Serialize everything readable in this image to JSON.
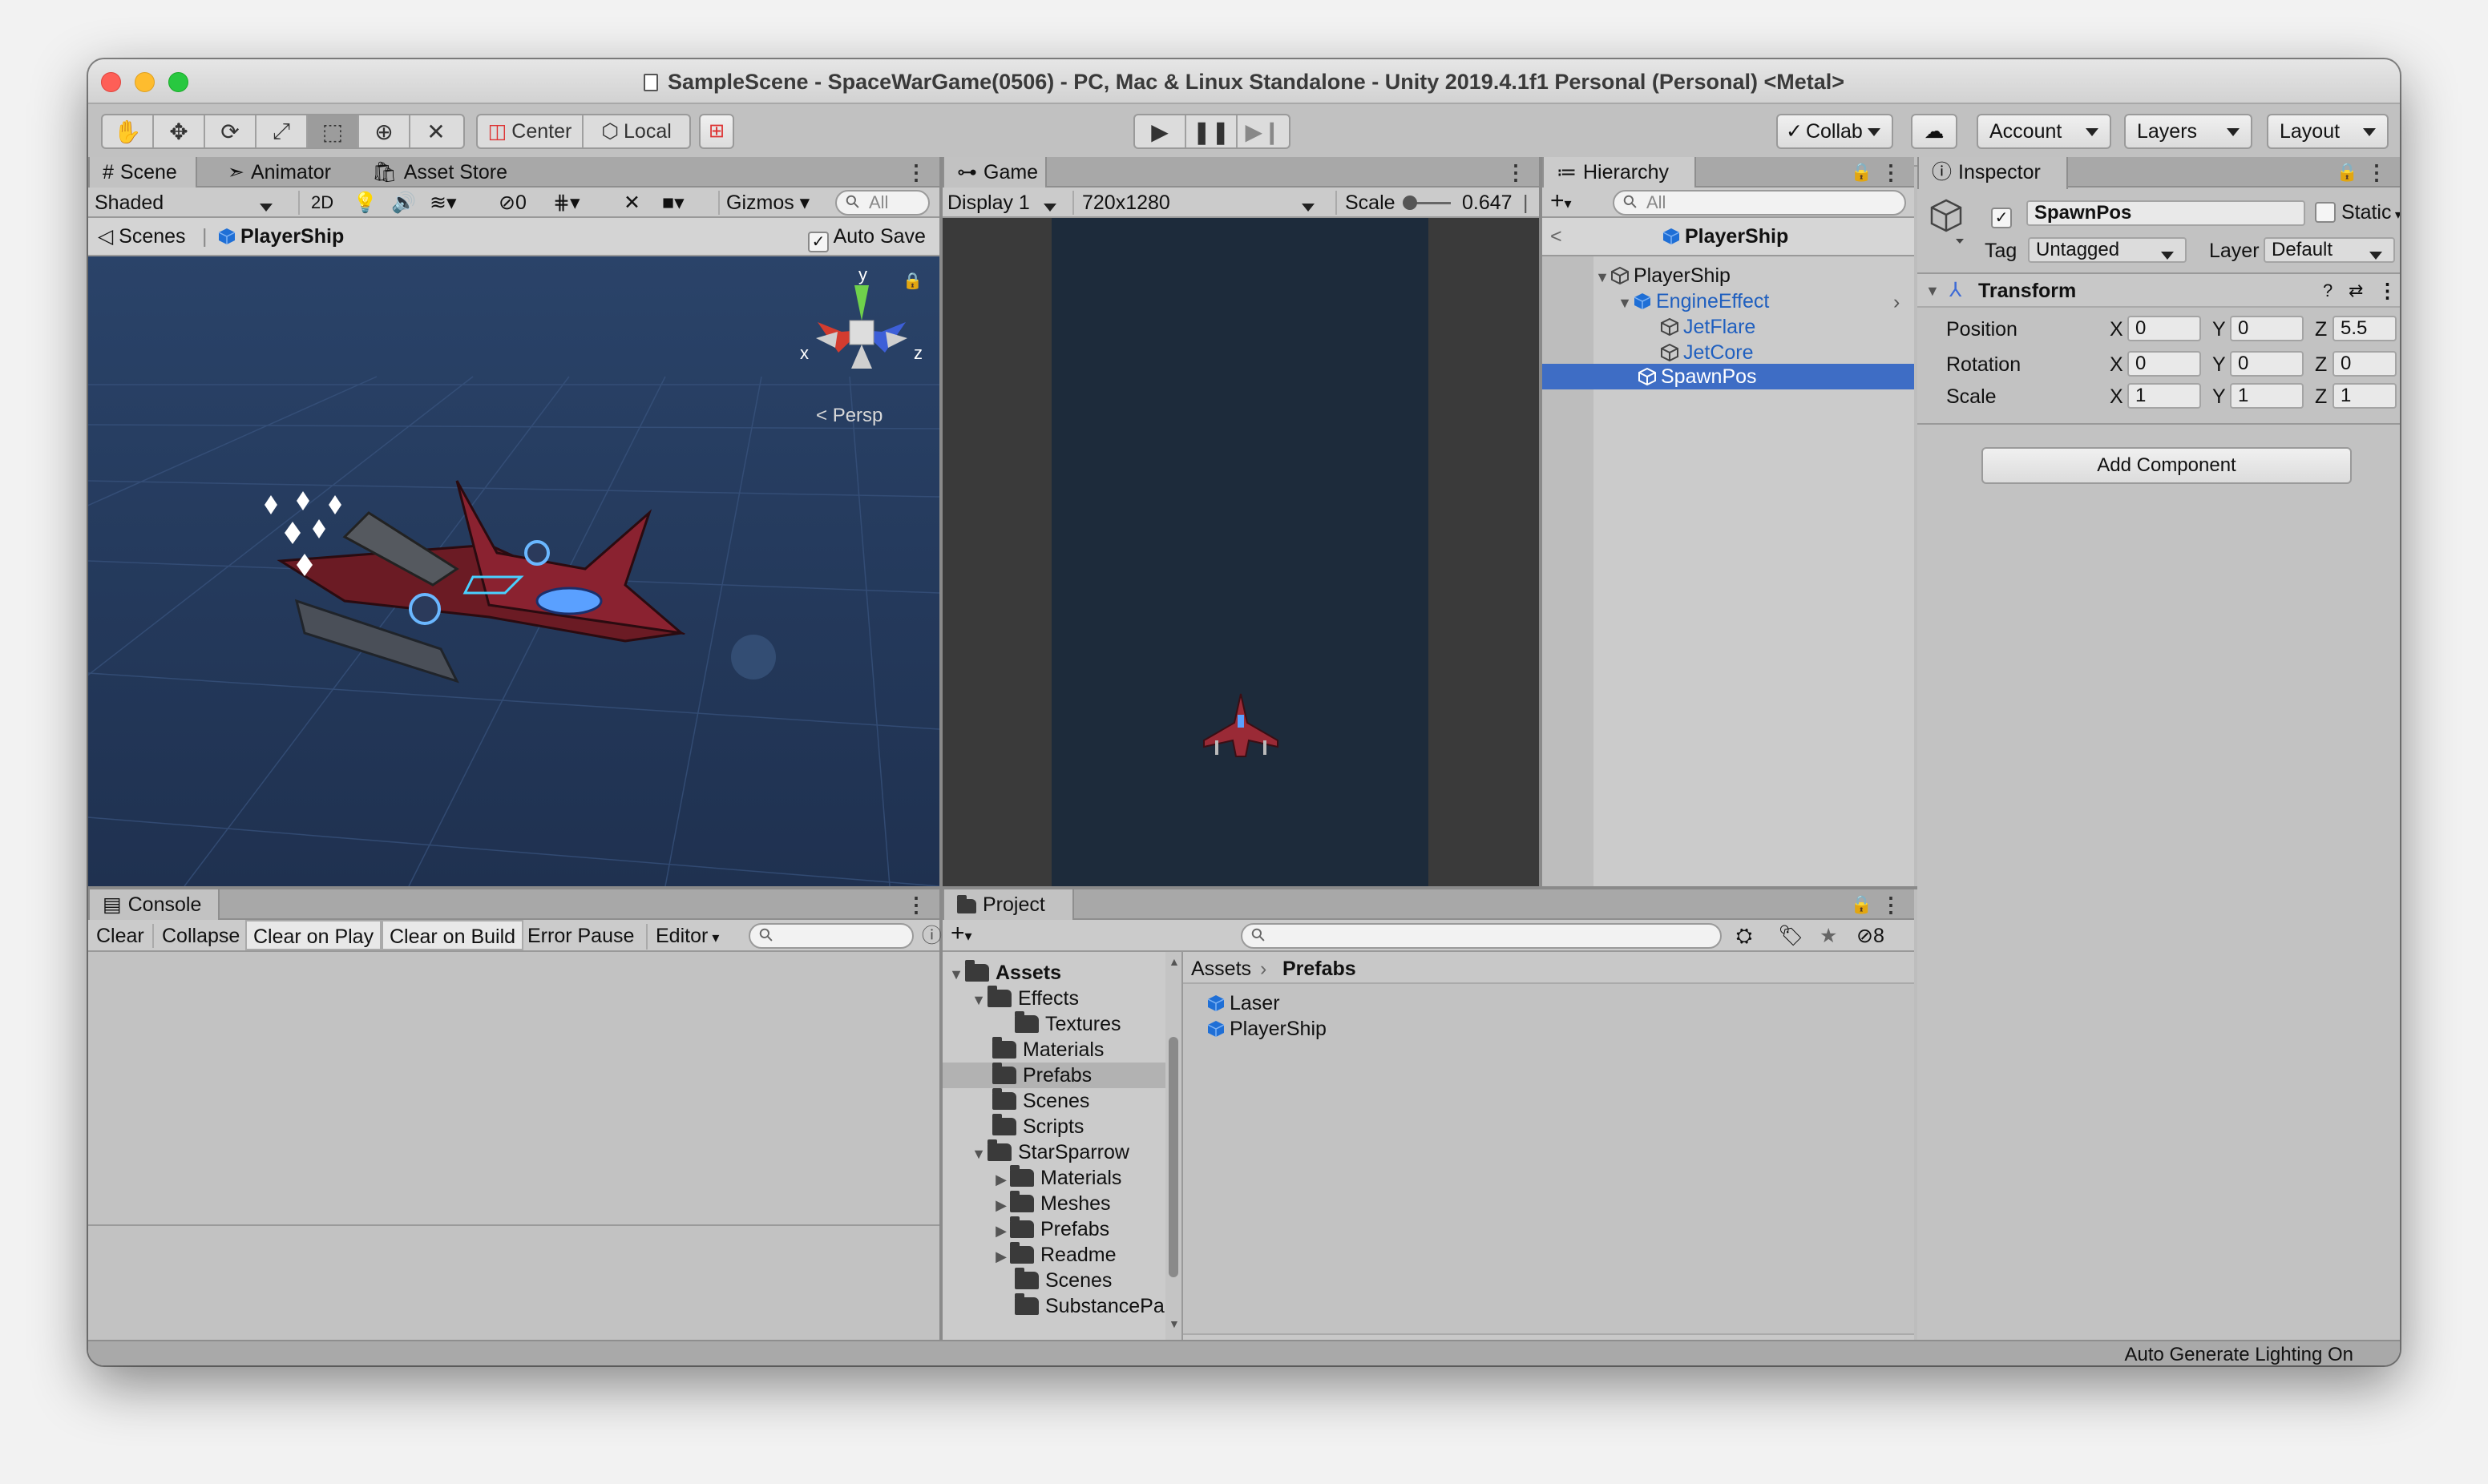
{
  "window": {
    "title": "SampleScene - SpaceWarGame(0506) - PC, Mac & Linux Standalone - Unity 2019.4.1f1 Personal (Personal) <Metal>",
    "traffic_colors": {
      "close": "#fe5f57",
      "minimize": "#febc2e",
      "zoom": "#28c840"
    }
  },
  "toolbar": {
    "tools": [
      "hand-tool-icon",
      "move-tool-icon",
      "rotate-tool-icon",
      "scale-tool-icon",
      "rect-tool-icon",
      "transform-tool-icon",
      "custom-tool-icon"
    ],
    "pivot_label": "Center",
    "space_label": "Local",
    "collab_label": "Collab",
    "account_label": "Account",
    "layers_label": "Layers",
    "layout_label": "Layout"
  },
  "scene": {
    "tabs": [
      "Scene",
      "Animator",
      "Asset Store"
    ],
    "shading": "Shaded",
    "mode_2d": "2D",
    "hidden_count": "0",
    "gizmos_label": "Gizmos",
    "search_placeholder": "All",
    "breadcrumb_root": "Scenes",
    "breadcrumb_current": "PlayerShip",
    "auto_save_label": "Auto Save",
    "auto_save_checked": true,
    "gizmo_axis": {
      "y": "y",
      "x": "x",
      "z": "z"
    },
    "projection": "Persp",
    "bg_color": "#233a5c"
  },
  "game": {
    "tab": "Game",
    "display": "Display 1",
    "resolution": "720x1280",
    "scale_label": "Scale",
    "scale_value": "0.647",
    "bg_color": "#1d2b3b"
  },
  "hierarchy": {
    "tab": "Hierarchy",
    "search_placeholder": "All",
    "context_title": "PlayerShip",
    "items": [
      {
        "label": "PlayerShip"
      },
      {
        "label": "EngineEffect"
      },
      {
        "label": "JetFlare"
      },
      {
        "label": "JetCore"
      },
      {
        "label": "SpawnPos"
      }
    ]
  },
  "inspector": {
    "tab": "Inspector",
    "object_name": "SpawnPos",
    "active_checked": true,
    "static_label": "Static",
    "tag_label": "Tag",
    "tag_value": "Untagged",
    "layer_label": "Layer",
    "layer_value": "Default",
    "component_title": "Transform",
    "position_label": "Position",
    "rotation_label": "Rotation",
    "scale_label": "Scale",
    "axis": {
      "x": "X",
      "y": "Y",
      "z": "Z"
    },
    "position": {
      "x": "0",
      "y": "0",
      "z": "5.5"
    },
    "rotation": {
      "x": "0",
      "y": "0",
      "z": "0"
    },
    "scale": {
      "x": "1",
      "y": "1",
      "z": "1"
    },
    "add_component_label": "Add Component"
  },
  "console": {
    "tab": "Console",
    "buttons": {
      "clear": "Clear",
      "collapse": "Collapse",
      "clear_on_play": "Clear on Play",
      "clear_on_build": "Clear on Build",
      "error_pause": "Error Pause",
      "editor": "Editor"
    }
  },
  "project": {
    "tab": "Project",
    "hidden_count": "8",
    "tree": [
      {
        "label": "Assets"
      },
      {
        "label": "Effects"
      },
      {
        "label": "Textures"
      },
      {
        "label": "Materials"
      },
      {
        "label": "Prefabs"
      },
      {
        "label": "Scenes"
      },
      {
        "label": "Scripts"
      },
      {
        "label": "StarSparrow"
      },
      {
        "label": "Materials"
      },
      {
        "label": "Meshes"
      },
      {
        "label": "Prefabs"
      },
      {
        "label": "Readme"
      },
      {
        "label": "Scenes"
      },
      {
        "label": "SubstancePain"
      }
    ],
    "path_root": "Assets",
    "path_current": "Prefabs",
    "files": [
      {
        "label": "Laser"
      },
      {
        "label": "PlayerShip"
      }
    ]
  },
  "status": {
    "text": "Auto Generate Lighting On"
  },
  "colors": {
    "selection": "#3e6dc5",
    "prefab_blue": "#1f6fd6",
    "panel_bg": "#c2c2c2",
    "tab_bar": "#a8a8a8"
  }
}
